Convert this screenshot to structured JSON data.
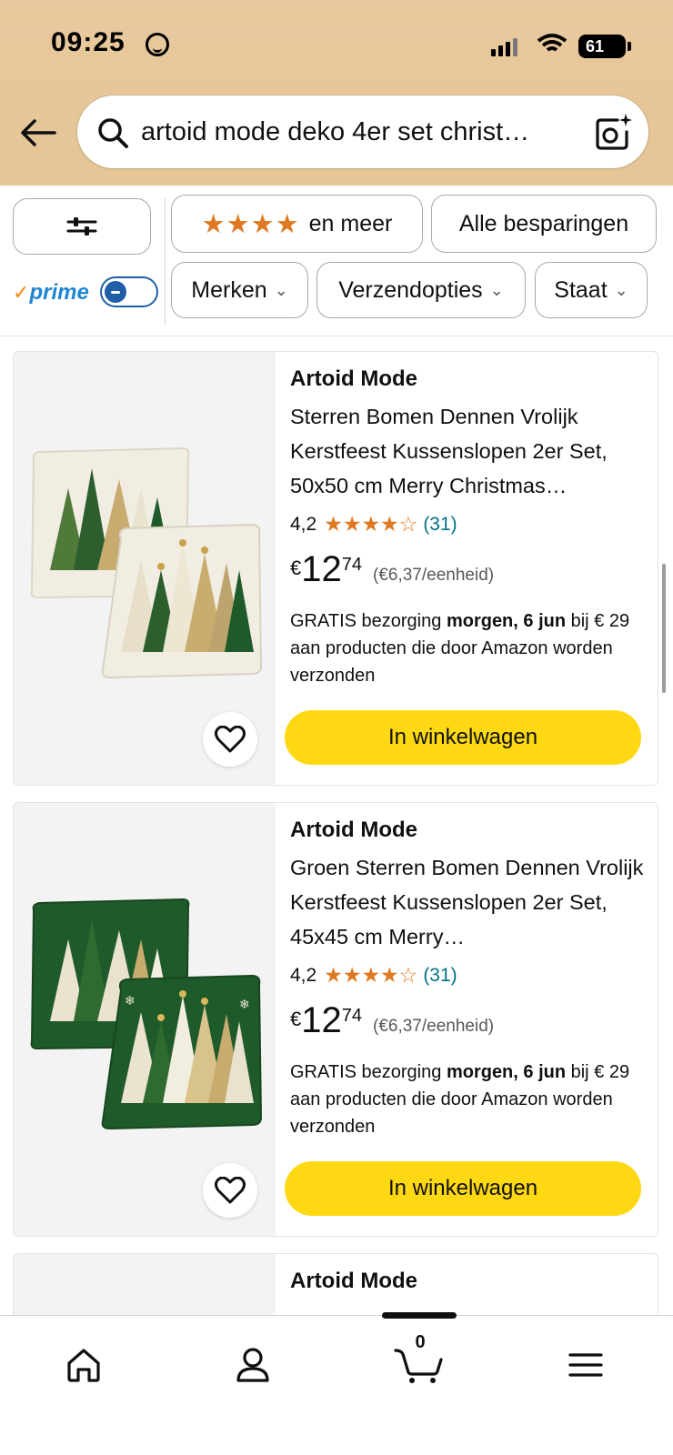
{
  "status_bar": {
    "time": "09:25",
    "battery": "61"
  },
  "search": {
    "query": "artoid mode deko 4er set christ…"
  },
  "filters": {
    "rating_label": "en meer",
    "rating_stars": "★★★★",
    "savings_label": "Alle besparingen",
    "prime_label": "prime",
    "prime_check": "✓",
    "brands_label": "Merken",
    "shipping_label": "Verzendopties",
    "condition_label": "Staat"
  },
  "results": [
    {
      "brand": "Artoid Mode",
      "title": "Sterren Bomen Dennen Vrolijk Kerstfeest Kussenslopen 2er Set, 50x50 cm Merry Christmas…",
      "rating": "4,2",
      "rating_stars": "★★★★☆",
      "rating_value": 4.2,
      "review_count": "(31)",
      "price_currency": "€",
      "price_whole": "12",
      "price_fraction": "74",
      "unit_price": "(€6,37/eenheid)",
      "delivery_prefix": "GRATIS bezorging ",
      "delivery_date": "morgen, 6 jun",
      "delivery_suffix": " bij € 29 aan producten die door Amazon worden verzonden",
      "cart_label": "In winkelwagen",
      "pillow_color": "#f1ede2"
    },
    {
      "brand": "Artoid Mode",
      "title": "Groen Sterren Bomen Dennen Vrolijk Kerstfeest Kussenslopen 2er Set, 45x45 cm Merry…",
      "rating": "4,2",
      "rating_stars": "★★★★☆",
      "rating_value": 4.2,
      "review_count": "(31)",
      "price_currency": "€",
      "price_whole": "12",
      "price_fraction": "74",
      "unit_price": "(€6,37/eenheid)",
      "delivery_prefix": "GRATIS bezorging ",
      "delivery_date": "morgen, 6 jun",
      "delivery_suffix": " bij € 29 aan producten die door Amazon worden verzonden",
      "cart_label": "In winkelwagen",
      "pillow_color": "#1f5a2a"
    },
    {
      "brand": "Artoid Mode"
    }
  ],
  "bottom_nav": {
    "cart_count": "0"
  },
  "colors": {
    "header_bg": "#e6c596",
    "cart_button": "#ffd814",
    "star": "#de7921",
    "prime_blue": "#1f86d2"
  }
}
